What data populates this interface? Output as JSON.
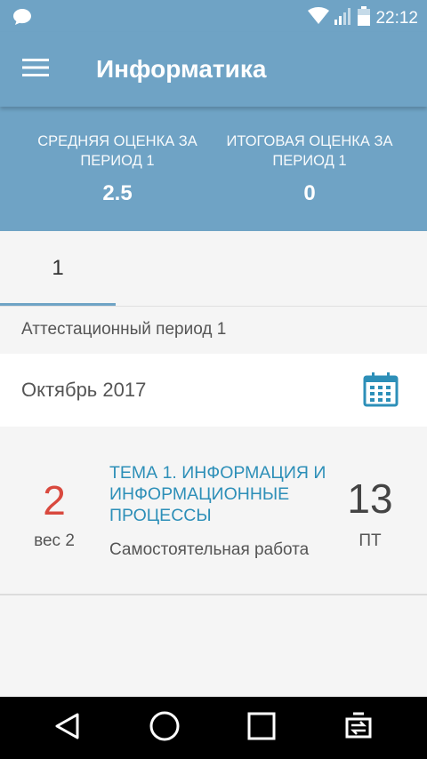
{
  "status_bar": {
    "time": "22:12",
    "icons": [
      "message-icon",
      "wifi-icon",
      "signal-icon",
      "battery-icon"
    ]
  },
  "app_bar": {
    "title": "Информатика",
    "menu_icon": "menu-icon"
  },
  "summary": {
    "average_label": "СРЕДНЯЯ ОЦЕНКА ЗА ПЕРИОД 1",
    "average_value": "2.5",
    "final_label": "ИТОГОВАЯ ОЦЕНКА ЗА ПЕРИОД 1",
    "final_value": "0"
  },
  "tabs": [
    {
      "label": "1",
      "selected": true
    }
  ],
  "period_label": "Аттестационный период 1",
  "month": {
    "label": "Октябрь 2017",
    "calendar_icon": "calendar-icon"
  },
  "lessons": [
    {
      "grade": "2",
      "weight": "вес 2",
      "topic": "ТЕМА 1. ИНФОРМАЦИЯ И ИНФОРМАЦИОННЫЕ ПРОЦЕССЫ",
      "work_type": "Самостоятельная работа",
      "day": "13",
      "weekday": "ПТ"
    }
  ],
  "colors": {
    "header": "#6fa3c5",
    "grade": "#d9493e",
    "topic": "#2d8fb8",
    "background": "#f5f5f5"
  },
  "nav_bar": {
    "icons": [
      "back-icon",
      "home-icon",
      "recents-icon",
      "rotate-icon"
    ]
  }
}
